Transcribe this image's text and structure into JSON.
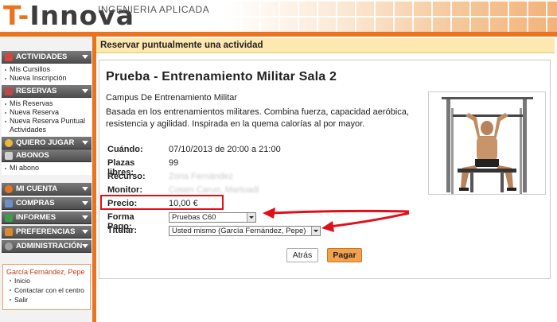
{
  "header": {
    "brand_prefix": "T-",
    "brand_name": "Innova",
    "tagline": "INGENIERIA APLICADA"
  },
  "colors": {
    "accent": "#e9731e",
    "title_bar": "#fde9b0",
    "highlight_red": "#e0101a",
    "pay_button": "#f3a14a"
  },
  "sidebar": {
    "sections": [
      {
        "label": "ACTIVIDADES",
        "icon": "calendar-icon",
        "items": [
          "Mis Cursillos",
          "Nueva Inscripción"
        ]
      },
      {
        "label": "RESERVAS",
        "icon": "ticket-icon",
        "items": [
          "Mis Reservas",
          "Nueva Reserva",
          "Nueva Reserva Puntual Actividades"
        ]
      },
      {
        "label": "QUIERO JUGAR",
        "icon": "ball-icon",
        "items": []
      },
      {
        "label": "ABONOS",
        "icon": "card-icon",
        "items": [
          "Mi abono"
        ]
      },
      {
        "label": "MI CUENTA",
        "icon": "user-icon",
        "items": []
      },
      {
        "label": "COMPRAS",
        "icon": "cart-icon",
        "items": []
      },
      {
        "label": "INFORMES",
        "icon": "chart-icon",
        "items": []
      },
      {
        "label": "PREFERENCIAS",
        "icon": "settings-icon",
        "items": []
      },
      {
        "label": "ADMINISTRACIÓN",
        "icon": "gear-icon",
        "items": []
      }
    ],
    "user": {
      "name": "García Fernández, Pepe",
      "links": [
        "Inicio",
        "Contactar con el centro",
        "Salir"
      ]
    }
  },
  "main": {
    "page_title": "Reservar puntualmente una actividad",
    "activity_title": "Prueba - Entrenamiento Militar Sala 2",
    "campus": "Campus De Entrenamiento Militar",
    "description": "Basada en los entrenamientos militares. Combina fuerza, capacidad aeróbica, resistencia y agilidad. Inspirada en la quema calorías al por mayor.",
    "fields": {
      "cuando_label": "Cuándo:",
      "cuando_value": "07/10/2013 de 20:00 a 21:00",
      "plazas_label": "Plazas libres:",
      "plazas_value": "99",
      "recurso_label": "Recurso:",
      "recurso_value": "Zona Fernández",
      "monitor_label": "Monitor:",
      "monitor_value": "Cosen Caruo, Martuadi",
      "precio_label": "Precio:",
      "precio_value": "10,00 €",
      "forma_pago_label": "Forma Pago:",
      "forma_pago_value": "Pruebas C60",
      "titular_label": "Titular:",
      "titular_value": "Usted mismo (García Fernández, Pepe)"
    },
    "buttons": {
      "back": "Atrás",
      "pay": "Pagar"
    }
  }
}
